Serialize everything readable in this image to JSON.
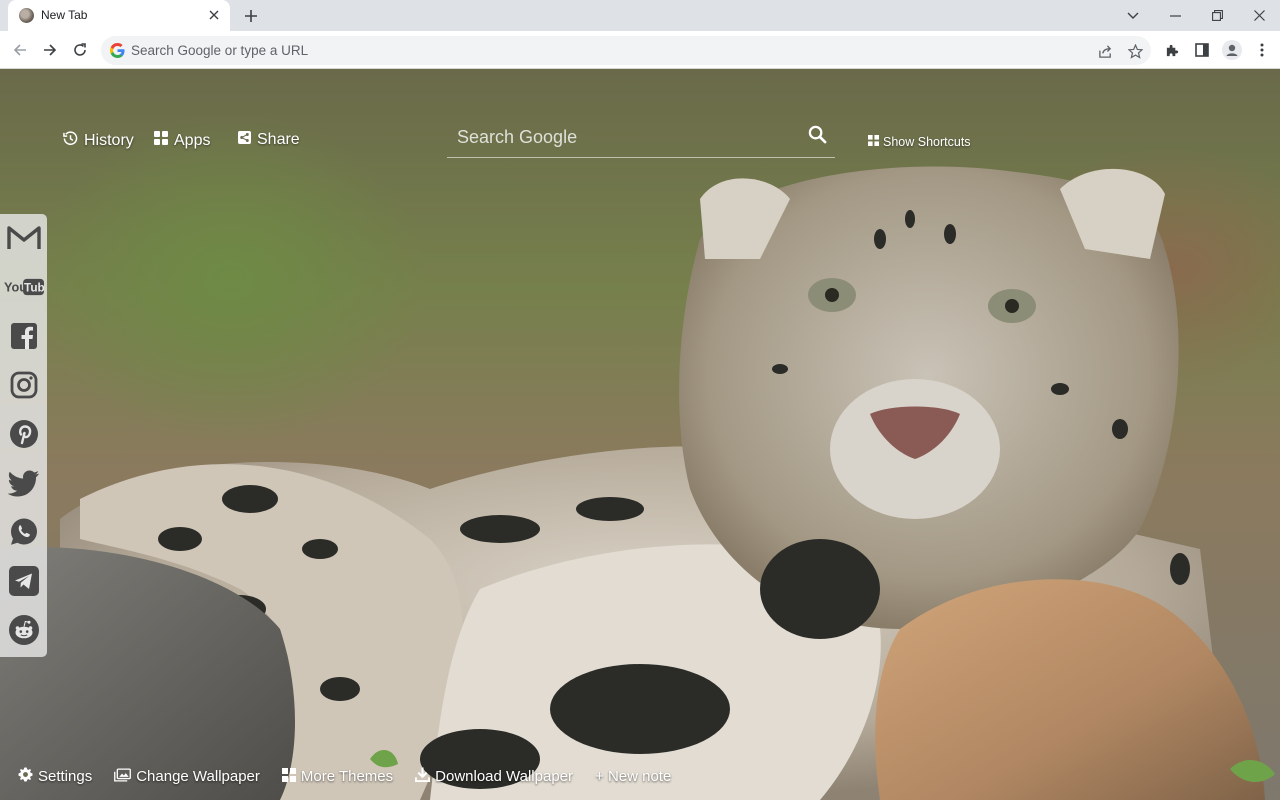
{
  "browser": {
    "tab_title": "New Tab",
    "omnibox_placeholder": "Search Google or type a URL"
  },
  "topnav": {
    "history_label": "History",
    "apps_label": "Apps",
    "share_label": "Share"
  },
  "search": {
    "placeholder": "Search Google"
  },
  "shortcuts_label": "Show Shortcuts",
  "sidebar_icons": [
    "gmail-icon",
    "youtube-icon",
    "facebook-icon",
    "instagram-icon",
    "pinterest-icon",
    "twitter-icon",
    "whatsapp-icon",
    "telegram-icon",
    "reddit-icon"
  ],
  "youtube_logo": {
    "part1": "You",
    "part2": "Tube"
  },
  "bottom": {
    "settings_label": "Settings",
    "change_wallpaper_label": "Change Wallpaper",
    "more_themes_label": "More Themes",
    "download_wallpaper_label": "Download Wallpaper",
    "new_note_label": "+ New note"
  },
  "colors": {
    "tabstrip": "#dee1e6",
    "omnibox": "#f1f3f4",
    "sidebar_icon": "#4a4a4a"
  }
}
